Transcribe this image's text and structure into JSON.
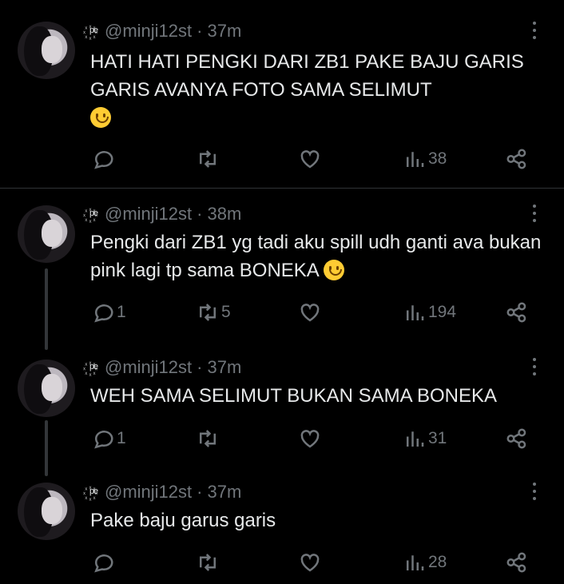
{
  "tweets": [
    {
      "handle": "@minji12st",
      "sep": "·",
      "time": "37m",
      "decoration": "꙰ᵖᵉ",
      "text": "HATI HATI PENGKI DARI ZB1 PAKE BAJU GARIS GARIS AVANYA FOTO SAMA SELIMUT",
      "emoji": "slightly-smiling-face",
      "replies": "",
      "retweets": "",
      "views": "38"
    },
    {
      "handle": "@minji12st",
      "sep": "·",
      "time": "38m",
      "decoration": "꙰ᵖᵉ",
      "text": "Pengki dari ZB1 yg tadi aku spill udh ganti ava bukan pink lagi tp sama BONEKA",
      "emoji": "slightly-smiling-face",
      "replies": "1",
      "retweets": "5",
      "views": "194"
    },
    {
      "handle": "@minji12st",
      "sep": "·",
      "time": "37m",
      "decoration": "꙰ᵖᵉ",
      "text": "WEH SAMA SELIMUT BUKAN SAMA BONEKA",
      "emoji": "",
      "replies": "1",
      "retweets": "",
      "views": "31"
    },
    {
      "handle": "@minji12st",
      "sep": "·",
      "time": "37m",
      "decoration": "꙰ᵖᵉ",
      "text": "Pake baju garus garis",
      "emoji": "",
      "replies": "",
      "retweets": "",
      "views": "28"
    }
  ],
  "icons": {
    "reply": "reply-icon",
    "retweet": "retweet-icon",
    "like": "heart-icon",
    "views": "views-chart-icon",
    "share": "share-icon",
    "more": "more-vertical-icon"
  },
  "colors": {
    "background": "#000000",
    "text": "#e7e9ea",
    "muted": "#71767b",
    "divider": "#2f3336"
  }
}
